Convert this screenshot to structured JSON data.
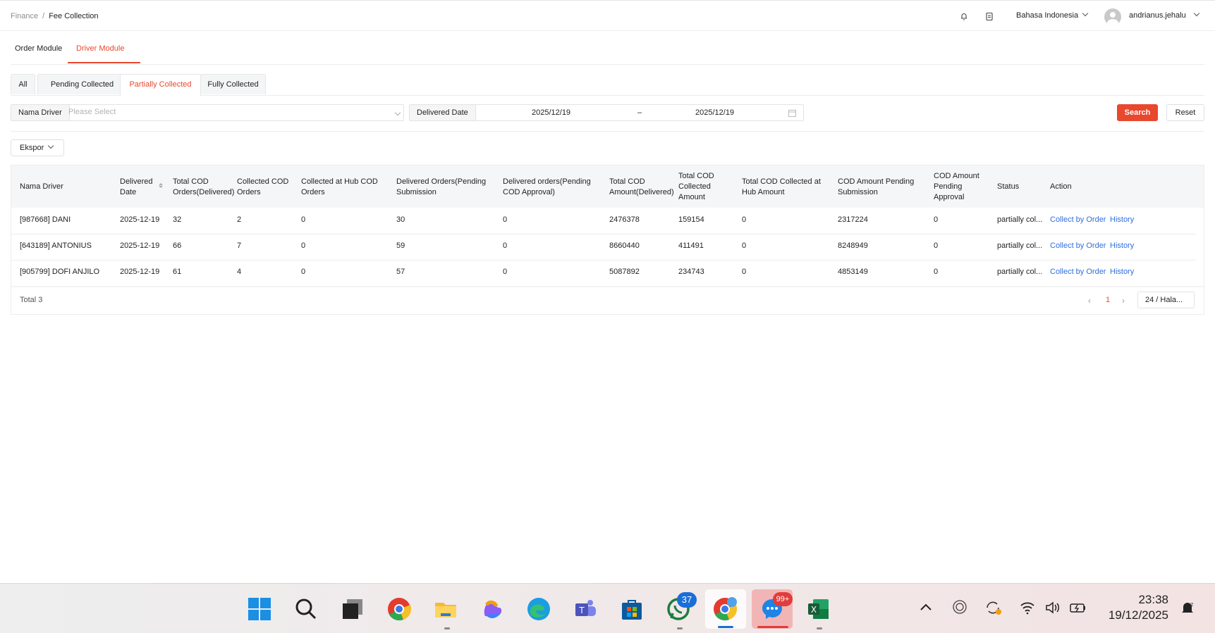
{
  "breadcrumb": {
    "parent": "Finance",
    "separator": "/",
    "current": "Fee Collection"
  },
  "header": {
    "language": "Bahasa Indonesia",
    "username": "andrianus.jehalu"
  },
  "module_tabs": [
    {
      "label": "Order Module",
      "active": false
    },
    {
      "label": "Driver Module",
      "active": true
    }
  ],
  "status_tabs": [
    {
      "label": "All",
      "active": false
    },
    {
      "label": "Pending Collected",
      "active": false
    },
    {
      "label": "Partially Collected",
      "active": true
    },
    {
      "label": "Fully Collected",
      "active": false
    }
  ],
  "filters": {
    "driver_label": "Nama Driver",
    "driver_placeholder": "Please Select",
    "date_label": "Delivered Date",
    "date_from": "2025/12/19",
    "date_sep": "–",
    "date_to": "2025/12/19",
    "search_label": "Search",
    "reset_label": "Reset"
  },
  "export_label": "Ekspor",
  "table": {
    "headers": {
      "driver": "Nama Driver",
      "date": [
        "Delivered",
        "Date"
      ],
      "total_cod_orders": [
        "Total COD",
        "Orders(Delivered)"
      ],
      "collected_cod_orders": [
        "Collected COD",
        "Orders"
      ],
      "collected_hub_orders": [
        "Collected at Hub COD",
        "Orders"
      ],
      "delivered_pending_sub": [
        "Delivered Orders(Pending",
        "Submission"
      ],
      "delivered_pending_app": [
        "Delivered orders(Pending",
        "COD Approval)"
      ],
      "total_cod_amount": [
        "Total COD",
        "Amount(Delivered)"
      ],
      "total_cod_collected": [
        "Total COD",
        "Collected",
        "Amount"
      ],
      "total_hub_amount": [
        "Total COD Collected at",
        "Hub Amount"
      ],
      "amount_pending_sub": [
        "COD Amount Pending",
        "Submission"
      ],
      "amount_pending_app": [
        "COD Amount",
        "Pending",
        "Approval"
      ],
      "status": "Status",
      "action": "Action"
    },
    "rows": [
      {
        "driver": "[987668] DANI",
        "date": "2025-12-19",
        "total_cod_orders": "32",
        "collected_cod_orders": "2",
        "collected_hub_orders": "0",
        "delivered_pending_sub": "30",
        "delivered_pending_app": "0",
        "total_cod_amount": "2476378",
        "total_cod_collected": "159154",
        "total_hub_amount": "0",
        "amount_pending_sub": "2317224",
        "amount_pending_app": "0",
        "status": "partially col...",
        "action_collect": "Collect by Order",
        "action_history": "History"
      },
      {
        "driver": "[643189] ANTONIUS",
        "date": "2025-12-19",
        "total_cod_orders": "66",
        "collected_cod_orders": "7",
        "collected_hub_orders": "0",
        "delivered_pending_sub": "59",
        "delivered_pending_app": "0",
        "total_cod_amount": "8660440",
        "total_cod_collected": "411491",
        "total_hub_amount": "0",
        "amount_pending_sub": "8248949",
        "amount_pending_app": "0",
        "status": "partially col...",
        "action_collect": "Collect by Order",
        "action_history": "History"
      },
      {
        "driver": "[905799] DOFI ANJILO",
        "date": "2025-12-19",
        "total_cod_orders": "61",
        "collected_cod_orders": "4",
        "collected_hub_orders": "0",
        "delivered_pending_sub": "57",
        "delivered_pending_app": "0",
        "total_cod_amount": "5087892",
        "total_cod_collected": "234743",
        "total_hub_amount": "0",
        "amount_pending_sub": "4853149",
        "amount_pending_app": "0",
        "status": "partially col...",
        "action_collect": "Collect by Order",
        "action_history": "History"
      }
    ]
  },
  "pagination": {
    "total": "Total 3",
    "current_page": "1",
    "page_size": "24 / Hala..."
  },
  "taskbar": {
    "icons": [
      "windows-start-icon",
      "search-icon",
      "task-view-icon",
      "chrome-icon",
      "file-explorer-icon",
      "copilot-icon",
      "edge-icon",
      "teams-icon",
      "microsoft-store-icon",
      "whatsapp-icon",
      "chrome-profile-icon",
      "messenger-icon",
      "excel-icon"
    ],
    "whatsapp_badge": "37",
    "messenger_badge": "99+",
    "time": "23:38",
    "date": "19/12/2025"
  },
  "colors": {
    "accent": "#e8482e",
    "link": "#2f6fdc"
  }
}
